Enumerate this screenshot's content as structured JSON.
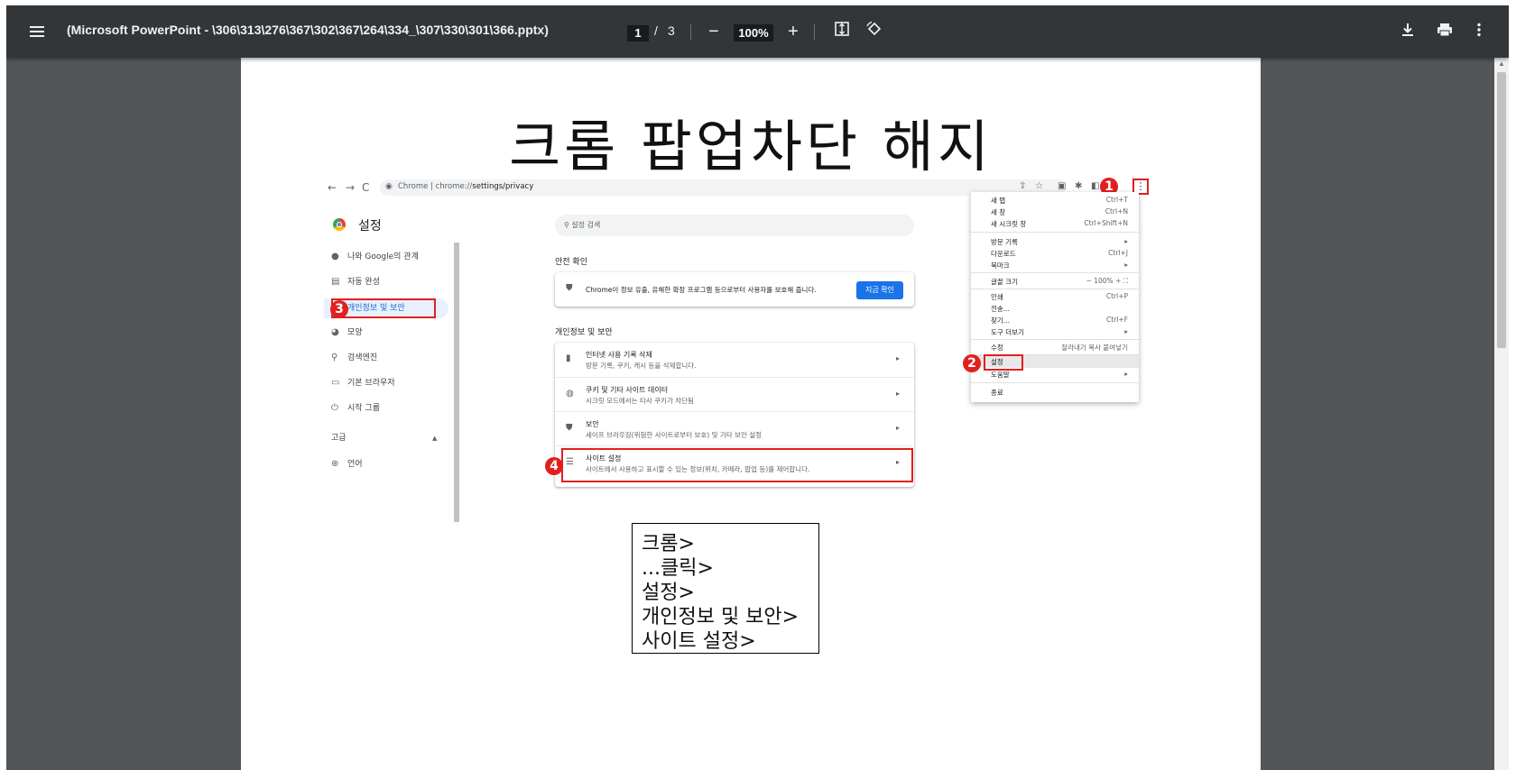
{
  "toolbar": {
    "title": "(Microsoft PowerPoint - \\306\\313\\276\\367\\302\\367\\264\\334_\\307\\330\\301\\366.pptx)",
    "current_page": "1",
    "page_separator": "/",
    "total_pages": "3",
    "zoom": "100%",
    "zoom_out": "−",
    "zoom_in": "+"
  },
  "slide": {
    "title": "크롬 팝업차단 해지",
    "caption_lines": [
      "크롬>",
      "...클릭>",
      "설정>",
      "개인정보 및 보안>",
      "사이트 설정>"
    ]
  },
  "screenshot": {
    "omnibox": {
      "prefix": "Chrome |",
      "url_gray": "chrome://",
      "url_dark": "settings/privacy"
    },
    "settings_title": "설정",
    "search_placeholder": "설정 검색",
    "sidebar": [
      {
        "icon": "person",
        "label": "나와 Google의 관계"
      },
      {
        "icon": "clipboard",
        "label": "자동 완성"
      },
      {
        "icon": "shield",
        "label": "개인정보 및 보안"
      },
      {
        "icon": "palette",
        "label": "모양"
      },
      {
        "icon": "search",
        "label": "검색엔진"
      },
      {
        "icon": "browser",
        "label": "기본 브라우저"
      },
      {
        "icon": "power",
        "label": "시작 그룹"
      },
      {
        "icon": "",
        "label": "고급"
      },
      {
        "icon": "globe",
        "label": "언어"
      }
    ],
    "safety_heading": "안전 확인",
    "safety_text": "Chrome이 정보 유출, 유해한 확장 프로그램 등으로부터 사용자를 보호해 줍니다.",
    "safety_button": "지금 확인",
    "privacy_heading": "개인정보 및 보안",
    "privacy_rows": [
      {
        "title": "인터넷 사용 기록 삭제",
        "sub": "방문 기록, 쿠키, 캐시 등을 삭제합니다."
      },
      {
        "title": "쿠키 및 기타 사이트 데이터",
        "sub": "시크릿 모드에서는 타사 쿠키가 차단됨"
      },
      {
        "title": "보안",
        "sub": "세이프 브라우징(위험한 사이트로부터 보호) 및 기타 보안 설정"
      },
      {
        "title": "사이트 설정",
        "sub": "사이트에서 사용하고 표시할 수 있는 정보(위치, 카메라, 팝업 등)를 제어합니다."
      }
    ],
    "menu": {
      "items": [
        {
          "label": "새 탭",
          "shortcut": "Ctrl+T"
        },
        {
          "label": "새 창",
          "shortcut": "Ctrl+N"
        },
        {
          "label": "새 시크릿 창",
          "shortcut": "Ctrl+Shift+N"
        },
        {
          "label": "방문 기록",
          "shortcut": "▸"
        },
        {
          "label": "다운로드",
          "shortcut": "Ctrl+J"
        },
        {
          "label": "북마크",
          "shortcut": "▸"
        },
        {
          "label": "글꼴 크기",
          "shortcut": "−   100%   +      ⛶"
        },
        {
          "label": "인쇄",
          "shortcut": "Ctrl+P"
        },
        {
          "label": "전송...",
          "shortcut": ""
        },
        {
          "label": "찾기...",
          "shortcut": "Ctrl+F"
        },
        {
          "label": "도구 더보기",
          "shortcut": "▸"
        },
        {
          "label": "수정",
          "shortcut": "잘라내기      복사      붙여넣기"
        },
        {
          "label": "설정",
          "shortcut": ""
        },
        {
          "label": "도움말",
          "shortcut": "▸"
        },
        {
          "label": "종료",
          "shortcut": ""
        }
      ]
    },
    "step_numbers": [
      "1",
      "2",
      "3",
      "4"
    ]
  }
}
